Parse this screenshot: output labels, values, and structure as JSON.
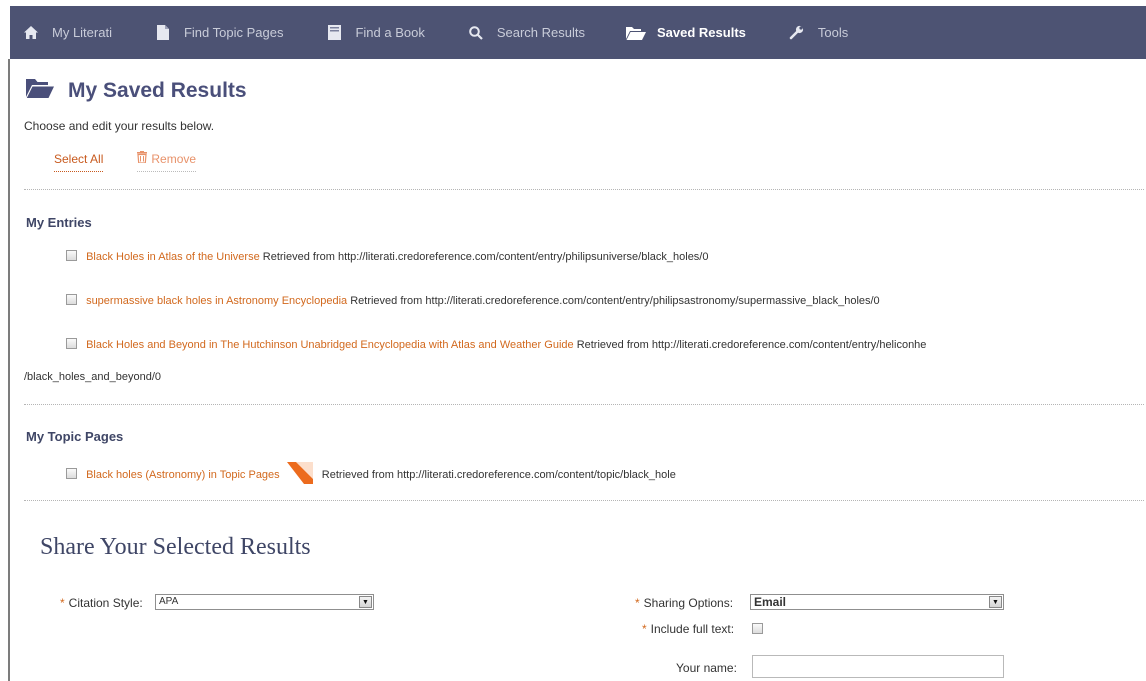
{
  "nav": {
    "items": [
      {
        "label": "My Literati",
        "icon": "home-icon"
      },
      {
        "label": "Find Topic Pages",
        "icon": "file-icon"
      },
      {
        "label": "Find a Book",
        "icon": "book-icon"
      },
      {
        "label": "Search Results",
        "icon": "search-icon"
      },
      {
        "label": "Saved Results",
        "icon": "folder-open-icon",
        "active": true
      },
      {
        "label": "Tools",
        "icon": "wrench-icon"
      }
    ]
  },
  "page": {
    "title": "My Saved Results",
    "intro": "Choose and edit your results below.",
    "select_all": "Select All",
    "remove": "Remove"
  },
  "entries_section": {
    "title": "My Entries",
    "items": [
      {
        "link": "Black Holes in Atlas of the Universe",
        "retrieved": "Retrieved from http://literati.credoreference.com/content/entry/philipsuniverse/black_holes/0"
      },
      {
        "link": "supermassive black holes in Astronomy Encyclopedia",
        "retrieved": "Retrieved from http://literati.credoreference.com/content/entry/philipsastronomy/supermassive_black_holes/0"
      },
      {
        "link": "Black Holes and Beyond in The Hutchinson Unabridged Encyclopedia with Atlas and Weather Guide",
        "retrieved": "Retrieved from http://literati.credoreference.com/content/entry/heliconhe",
        "retrieved_cont": "/black_holes_and_beyond/0"
      }
    ]
  },
  "topics_section": {
    "title": "My Topic Pages",
    "items": [
      {
        "link": "Black holes (Astronomy) in Topic Pages",
        "retrieved": "Retrieved from http://literati.credoreference.com/content/topic/black_hole"
      }
    ]
  },
  "share": {
    "title": "Share Your Selected Results",
    "citation_label": "Citation Style:",
    "citation_value": "APA",
    "sharing_label": "Sharing Options:",
    "sharing_value": "Email",
    "fulltext_label": "Include full text:",
    "name_label": "Your name:",
    "name_value": "",
    "required_marker": "*"
  },
  "colors": {
    "nav_bg": "#4d5373",
    "title": "#4a4f7a",
    "link": "#d2691e"
  }
}
